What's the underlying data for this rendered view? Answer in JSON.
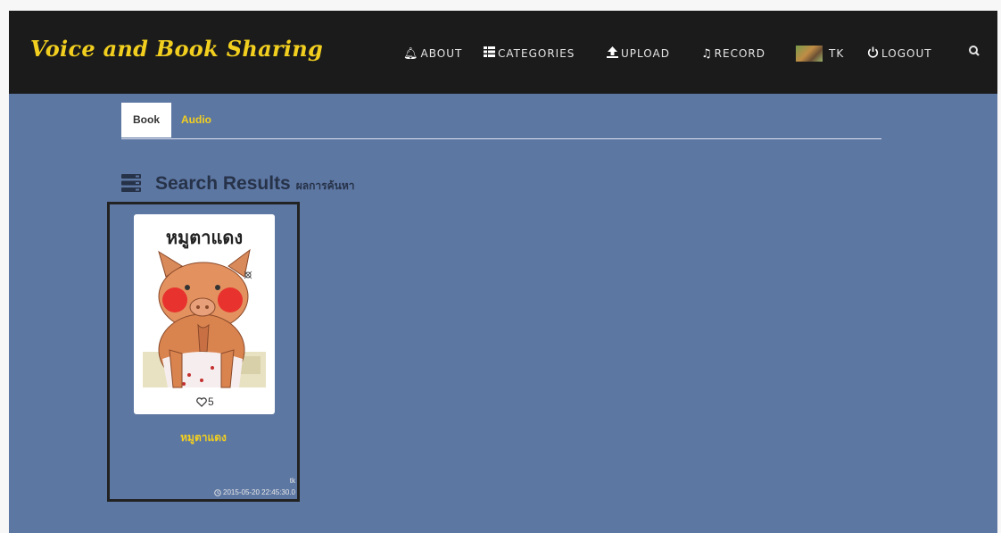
{
  "brand": "Voice and Book Sharing",
  "nav": {
    "about": "ABOUT",
    "categories": "CATEGORIES",
    "upload": "UPLOAD",
    "record": "RECORD",
    "user": "TK",
    "logout": "LOGOUT"
  },
  "tabs": {
    "book": "Book",
    "audio": "Audio",
    "active": "Book"
  },
  "heading": {
    "title": "Search Results",
    "subtitle": "ผลการค้นหา"
  },
  "results": [
    {
      "cover_title": "หมูตาแดง",
      "title": "หมูตาแดง",
      "likes": "5",
      "uploader": "tk",
      "datetime": "2015-05-20  22:45:30.0"
    }
  ],
  "colors": {
    "navbar": "#1b1b1b",
    "background": "#5d77a3",
    "accent": "#f2cf1f",
    "heading": "#263248"
  },
  "icons": [
    "bell-icon",
    "categories-grid-icon",
    "upload-icon",
    "music-note-icon",
    "avatar",
    "power-icon",
    "search-icon",
    "list-icon",
    "heart-icon",
    "clock-icon"
  ]
}
